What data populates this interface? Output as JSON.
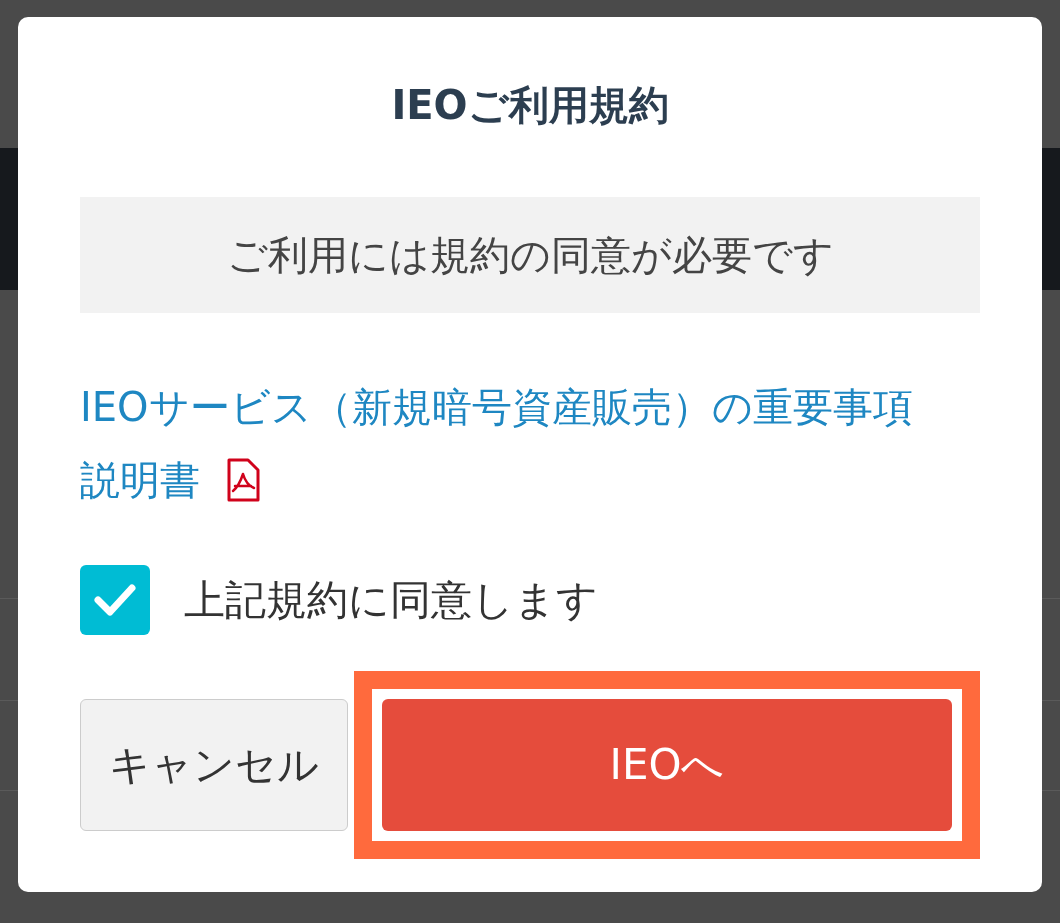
{
  "dialog": {
    "title": "IEOご利用規約",
    "notice": "ご利用には規約の同意が必要です",
    "document_link": "IEOサービス（新規暗号資産販売）の重要事項説明書",
    "agreement": {
      "label": "上記規約に同意します",
      "checked": true
    },
    "buttons": [
      {
        "kind": "secondary",
        "label": "キャンセル",
        "highlighted": false
      },
      {
        "kind": "primary",
        "label": "IEOへ",
        "highlighted": true
      }
    ]
  }
}
